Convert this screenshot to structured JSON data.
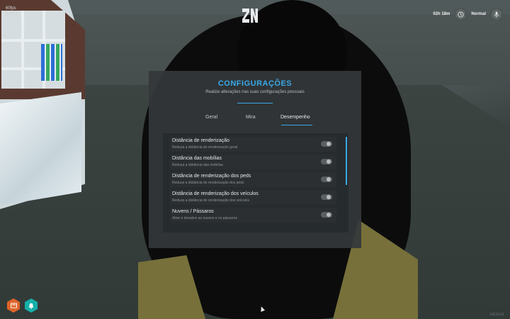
{
  "hud": {
    "fps_lines": [
      "60fps",
      "21ping"
    ],
    "clock_label": "",
    "clock_value": "02h 18m",
    "voice_label": "",
    "voice_value": "Normal",
    "clock_icon": "clock-icon",
    "voice_icon": "microphone-icon"
  },
  "settings": {
    "title": "CONFIGURAÇÕES",
    "subtitle": "Realize alterações nas suas configurações pessoais",
    "tabs": [
      {
        "label": "Geral",
        "active": false
      },
      {
        "label": "Mira",
        "active": false
      },
      {
        "label": "Desempenho",
        "active": true
      }
    ],
    "options": [
      {
        "title": "Distância de renderização",
        "desc": "Reduza a distância de renderização geral",
        "enabled": false
      },
      {
        "title": "Distância das mobílias",
        "desc": "Reduza a distância das mobílias",
        "enabled": false
      },
      {
        "title": "Distância de renderização dos peds",
        "desc": "Reduza a distância de renderização dos peds",
        "enabled": false
      },
      {
        "title": "Distância de renderização dos veículos",
        "desc": "Reduza a distância de renderização dos veículos",
        "enabled": false
      },
      {
        "title": "Nuvens / Pássaros",
        "desc": "Ative e desative as nuvens e os pássaros",
        "enabled": false
      }
    ]
  },
  "bottom_icons": [
    "package-icon",
    "notification-bell-icon"
  ],
  "watermark": "NEXUS",
  "colors": {
    "accent": "#3aa8e8",
    "orange_button": "#e0642a",
    "teal_button": "#16b0a8"
  }
}
